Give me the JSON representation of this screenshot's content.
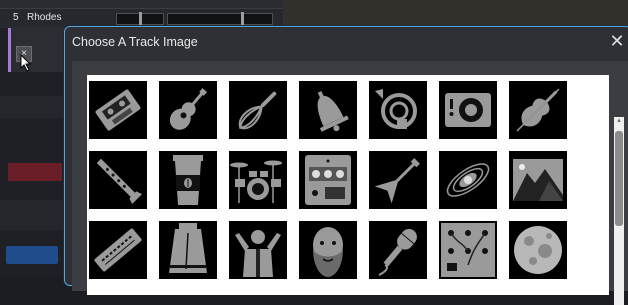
{
  "track": {
    "number": "5",
    "name": "Rhodes",
    "close_glyph": "×"
  },
  "dialog": {
    "title": "Choose A Track Image",
    "close_glyph": "✕"
  },
  "images": [
    {
      "name": "cassette-tape-icon"
    },
    {
      "name": "acoustic-guitar-icon"
    },
    {
      "name": "whisk-icon"
    },
    {
      "name": "bell-icon"
    },
    {
      "name": "french-horn-icon"
    },
    {
      "name": "speaker-icon"
    },
    {
      "name": "violin-icon"
    },
    {
      "name": "clarinet-icon"
    },
    {
      "name": "coffee-cup-icon"
    },
    {
      "name": "drum-kit-icon"
    },
    {
      "name": "effects-pedal-icon"
    },
    {
      "name": "electric-guitar-icon"
    },
    {
      "name": "galaxy-icon"
    },
    {
      "name": "mountain-landscape-icon"
    },
    {
      "name": "harmonica-icon"
    },
    {
      "name": "liberty-bell-icon"
    },
    {
      "name": "conductor-icon"
    },
    {
      "name": "bearded-face-icon"
    },
    {
      "name": "microphone-icon"
    },
    {
      "name": "synth-module-icon"
    },
    {
      "name": "moon-icon"
    }
  ]
}
